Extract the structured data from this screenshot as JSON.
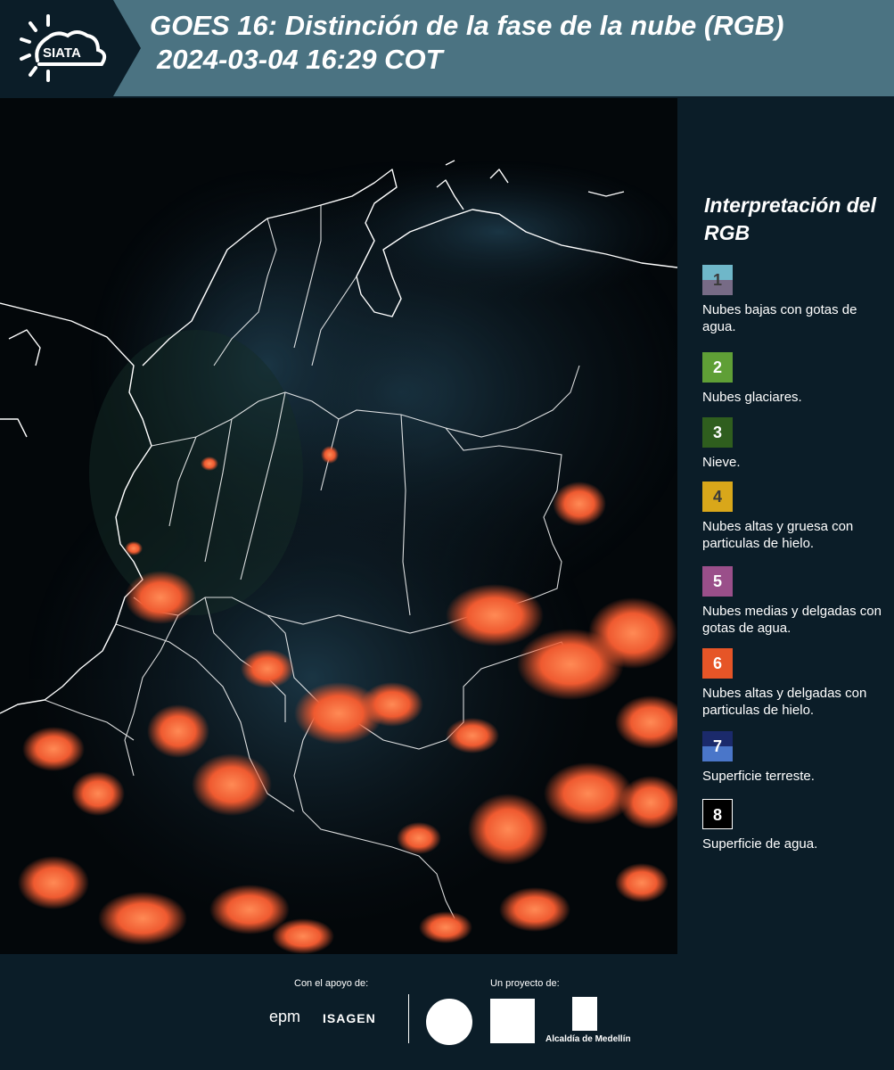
{
  "header": {
    "logo_text": "SIATA",
    "title_line1": "GOES 16: Distinción de la fase de la nube (RGB)",
    "title_line2": "2024-03-04 16:29 COT"
  },
  "legend": {
    "title": "Interpretación del RGB",
    "items": [
      {
        "number": "1",
        "label": "Nubes bajas con gotas de agua.",
        "color_top": "#6fb7c9",
        "color_bottom": "#776b86"
      },
      {
        "number": "2",
        "label": "Nubes glaciares.",
        "color": "#5f9f36"
      },
      {
        "number": "3",
        "label": "Nieve.",
        "color": "#2f5e1e"
      },
      {
        "number": "4",
        "label": "Nubes altas y gruesa con particulas de hielo.",
        "color": "#d9a71a"
      },
      {
        "number": "5",
        "label": "Nubes medias y delgadas con gotas de agua.",
        "color": "#9a4f8a"
      },
      {
        "number": "6",
        "label": "Nubes altas y delgadas con particulas de hielo.",
        "color": "#e65527"
      },
      {
        "number": "7",
        "label": "Superficie terreste.",
        "color_top": "#1b2a6b",
        "color_bottom": "#4a76c9"
      },
      {
        "number": "8",
        "label": "Superficie de agua.",
        "color": "#000000"
      }
    ]
  },
  "footer": {
    "support_label": "Con el apoyo de:",
    "project_label": "Un proyecto de:",
    "epm": "epm",
    "isagen": "ISAGEN",
    "alcaldia": "Alcaldía de Medellín"
  }
}
